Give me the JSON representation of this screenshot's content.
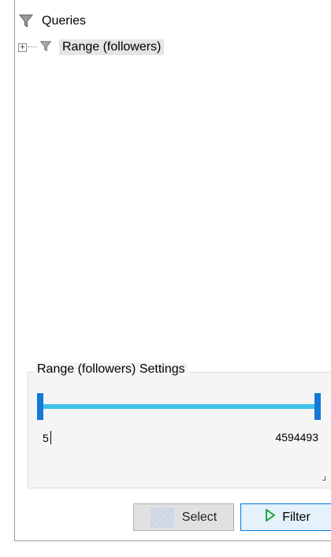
{
  "tree": {
    "root_label": "Queries",
    "root_icon": "funnel-icon",
    "child_label": "Range (followers)",
    "child_icon": "funnel-icon",
    "child_expander": "+"
  },
  "settings": {
    "title": "Range (followers) Settings",
    "range_min": "5",
    "range_max": "4594493",
    "track_color": "#40c0e8",
    "handle_color": "#1478d7"
  },
  "buttons": {
    "select_label": "Select",
    "select_icon": "hatch-select-icon",
    "filter_label": "Filter",
    "filter_icon": "play-icon",
    "filter_icon_color": "#22a845"
  }
}
